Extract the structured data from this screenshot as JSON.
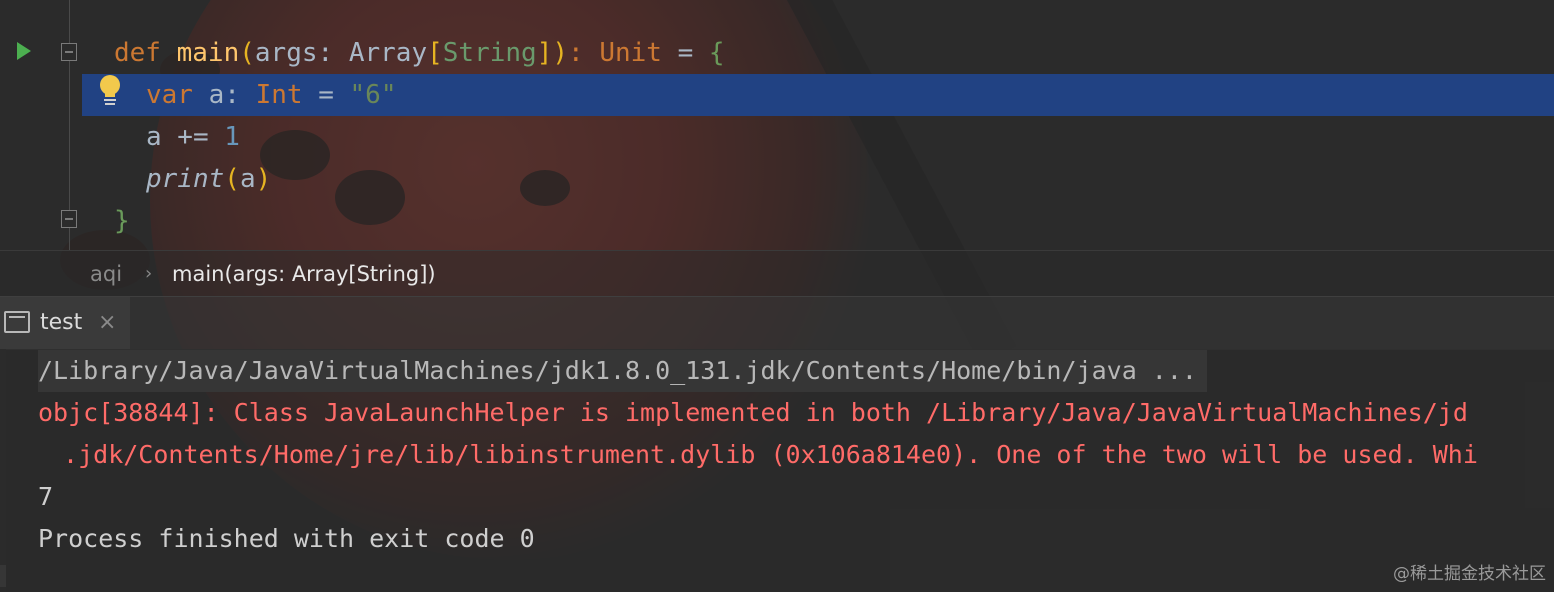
{
  "editor": {
    "line1": {
      "kw_def": "def",
      "fn_name": "main",
      "paren_open": "(",
      "param": "args: ",
      "type1": "Array",
      "bracket_open": "[",
      "type2": "String",
      "bracket_close": "]",
      "paren_close": ")",
      "sep": ": ",
      "ret_type": "Unit",
      "eq": " = ",
      "brace": "{"
    },
    "line2": {
      "kw_var": "var",
      "rest": " a: ",
      "type": "Int",
      "eq": " = ",
      "str": "\"6\""
    },
    "line3": {
      "text": "a += ",
      "num": "1"
    },
    "line4": {
      "fn": "print",
      "paren_open": "(",
      "arg": "a",
      "paren_close": ")"
    },
    "line5": {
      "brace": "}"
    }
  },
  "breadcrumb": {
    "item1": "aqi",
    "sep": "›",
    "item2": "main(args: Array[String])"
  },
  "tool_window": {
    "tab_label": "test",
    "close_glyph": "×"
  },
  "console": {
    "command": "/Library/Java/JavaVirtualMachines/jdk1.8.0_131.jdk/Contents/Home/bin/java ...",
    "error1": "objc[38844]: Class JavaLaunchHelper is implemented in both /Library/Java/JavaVirtualMachines/jd",
    "error2": " .jdk/Contents/Home/jre/lib/libinstrument.dylib (0x106a814e0). One of the two will be used. Whi",
    "output": "7",
    "exit": "Process finished with exit code 0"
  },
  "watermark": "@稀土掘金技术社区",
  "colors": {
    "keyword": "#cc7832",
    "function": "#ffc66d",
    "string": "#6a8759",
    "number": "#6897bb",
    "selection": "#214283",
    "error": "#ff6b68",
    "run": "#4caf50"
  }
}
